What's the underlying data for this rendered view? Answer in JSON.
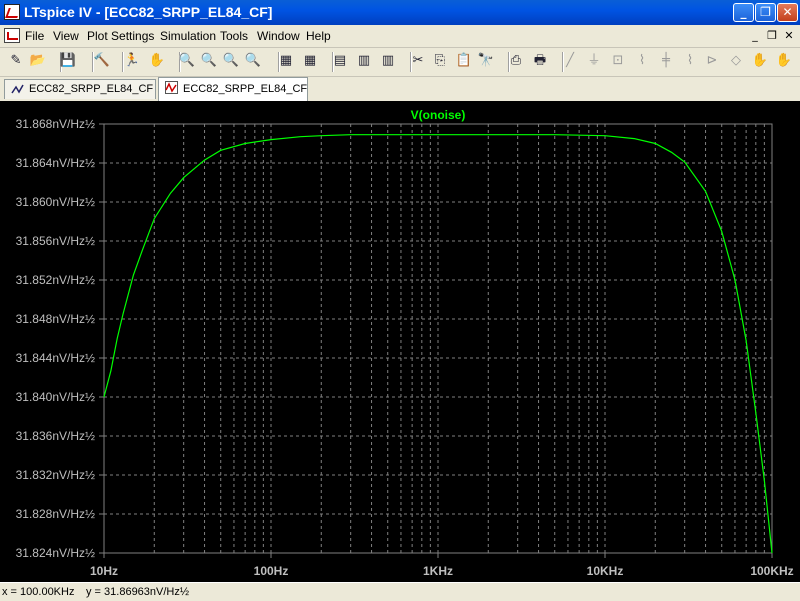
{
  "window": {
    "app": "LTspice IV",
    "title": "LTspice IV - [ECC82_SRPP_EL84_CF]",
    "buttons": [
      "_",
      "❐",
      "✕"
    ]
  },
  "menu": [
    "File",
    "View",
    "Plot Settings",
    "Simulation",
    "Tools",
    "Window",
    "Help"
  ],
  "mdi_buttons": [
    "_",
    "❐",
    "✕"
  ],
  "toolbar": [
    {
      "name": "new-schematic-icon",
      "glyph": "✎"
    },
    {
      "name": "open-icon",
      "glyph": "📂"
    },
    {
      "name": "save-icon",
      "glyph": "💾"
    },
    {
      "name": "control-panel-icon",
      "glyph": "🔨"
    },
    {
      "name": "run-icon",
      "glyph": "🏃"
    },
    {
      "name": "halt-icon",
      "glyph": "✋"
    },
    {
      "name": "zoom-in-icon",
      "glyph": "🔍"
    },
    {
      "name": "zoom-pan-icon",
      "glyph": "🔍"
    },
    {
      "name": "zoom-out-icon",
      "glyph": "🔍"
    },
    {
      "name": "zoom-fit-icon",
      "glyph": "🔍"
    },
    {
      "name": "autorange-icon",
      "glyph": "▦"
    },
    {
      "name": "pick-visible-traces-icon",
      "glyph": "▦"
    },
    {
      "name": "tile-horizontal-icon",
      "glyph": "▤"
    },
    {
      "name": "cascade-icon",
      "glyph": "▥"
    },
    {
      "name": "tile-vertical-icon",
      "glyph": "▥"
    },
    {
      "name": "cut-icon",
      "glyph": "✂"
    },
    {
      "name": "copy-icon",
      "glyph": "⎘"
    },
    {
      "name": "paste-icon",
      "glyph": "📋"
    },
    {
      "name": "find-icon",
      "glyph": "🔭"
    },
    {
      "name": "print-setup-icon",
      "glyph": "⎙"
    },
    {
      "name": "print-icon",
      "glyph": "🖶"
    },
    {
      "name": "wire-icon",
      "glyph": "╱",
      "dim": true
    },
    {
      "name": "ground-icon",
      "glyph": "⏚",
      "dim": true
    },
    {
      "name": "label-net-icon",
      "glyph": "⊡",
      "dim": true
    },
    {
      "name": "resistor-icon",
      "glyph": "⌇",
      "dim": true
    },
    {
      "name": "capacitor-icon",
      "glyph": "╪",
      "dim": true
    },
    {
      "name": "inductor-icon",
      "glyph": "⌇",
      "dim": true
    },
    {
      "name": "diode-icon",
      "glyph": "⊳",
      "dim": true
    },
    {
      "name": "component-icon",
      "glyph": "◇",
      "dim": true
    },
    {
      "name": "move-icon",
      "glyph": "✋",
      "dim": true
    },
    {
      "name": "drag-icon",
      "glyph": "✋",
      "dim": true
    }
  ],
  "tabs": [
    {
      "label": "ECC82_SRPP_EL84_CF",
      "active": false,
      "kind": "schematic"
    },
    {
      "label": "ECC82_SRPP_EL84_CF",
      "active": true,
      "kind": "waveform"
    }
  ],
  "status": {
    "x_readout": "x = 100.00KHz",
    "y_readout": "y = 31.86963nV/Hz½"
  },
  "colors": {
    "plot_bg": "#000000",
    "grid": "#808080",
    "trace": "#00ff00",
    "axis_text": "#bfbfbf"
  },
  "chart_data": {
    "type": "line",
    "title": "V(onoise)",
    "xlabel": "",
    "ylabel": "",
    "x_scale": "log",
    "xlim": [
      10,
      100000
    ],
    "ylim": [
      31.824,
      31.868
    ],
    "x_ticks": [
      {
        "value": 10,
        "label": "10Hz"
      },
      {
        "value": 100,
        "label": "100Hz"
      },
      {
        "value": 1000,
        "label": "1KHz"
      },
      {
        "value": 10000,
        "label": "10KHz"
      },
      {
        "value": 100000,
        "label": "100KHz"
      }
    ],
    "y_ticks": [
      {
        "value": 31.868,
        "label": "31.868nV/Hz½"
      },
      {
        "value": 31.864,
        "label": "31.864nV/Hz½"
      },
      {
        "value": 31.86,
        "label": "31.860nV/Hz½"
      },
      {
        "value": 31.856,
        "label": "31.856nV/Hz½"
      },
      {
        "value": 31.852,
        "label": "31.852nV/Hz½"
      },
      {
        "value": 31.848,
        "label": "31.848nV/Hz½"
      },
      {
        "value": 31.844,
        "label": "31.844nV/Hz½"
      },
      {
        "value": 31.84,
        "label": "31.840nV/Hz½"
      },
      {
        "value": 31.836,
        "label": "31.836nV/Hz½"
      },
      {
        "value": 31.832,
        "label": "31.832nV/Hz½"
      },
      {
        "value": 31.828,
        "label": "31.828nV/Hz½"
      },
      {
        "value": 31.824,
        "label": "31.824nV/Hz½"
      }
    ],
    "grid": true,
    "series": [
      {
        "name": "V(onoise)",
        "x": [
          10,
          11,
          12,
          13,
          15,
          17,
          20,
          25,
          30,
          40,
          50,
          70,
          100,
          150,
          200,
          300,
          500,
          1000,
          2000,
          5000,
          10000,
          15000,
          20000,
          25000,
          30000,
          40000,
          50000,
          60000,
          70000,
          80000,
          90000,
          100000
        ],
        "y": [
          31.84,
          31.8427,
          31.846,
          31.8485,
          31.8525,
          31.8551,
          31.8583,
          31.8609,
          31.8625,
          31.8643,
          31.8653,
          31.866,
          31.8664,
          31.8667,
          31.8668,
          31.8669,
          31.8669,
          31.8669,
          31.8669,
          31.8669,
          31.8668,
          31.8665,
          31.866,
          31.8651,
          31.8641,
          31.8611,
          31.857,
          31.852,
          31.8458,
          31.8384,
          31.8314,
          31.824
        ]
      }
    ]
  }
}
